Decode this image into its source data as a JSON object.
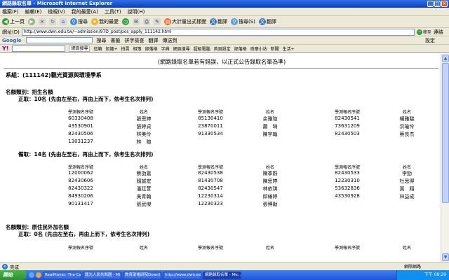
{
  "window": {
    "title": "網路錄取名單 - Microsoft Internet Explorer"
  },
  "menu": [
    "檔案(F)",
    "編輯(E)",
    "檢視(V)",
    "我的最愛(A)",
    "工具(T)",
    "說明(H)"
  ],
  "toolbar": {
    "back": "上一頁",
    "search": "搜尋",
    "favorites": "我的最愛",
    "print_ext": "大計量出式樣變",
    "translate": "翻譯",
    "search2": "搜尋(S)",
    "translate2": "翻譯"
  },
  "address": {
    "label": "網址(D)",
    "url": "http://www.dwn.edu.tw/~admission/97D_post/pos_apply_111142.html",
    "go": "移至",
    "links": "連結"
  },
  "google": {
    "label": "Google",
    "go": "搜尋",
    "bookmarks": "書籤",
    "spell": "拼字檢查",
    "translate": "翻譯",
    "send": "傳送到",
    "settings": "設定"
  },
  "yahoo": {
    "label": "Y!",
    "search_btn": "網頁搜尋",
    "items": [
      "信箱",
      "知識+",
      "拍賣",
      "相簿",
      "部落格",
      "字典",
      "網頁搜尋",
      "超級電腦",
      "首頁設定",
      "部落格",
      "奇摩小站",
      "新聞",
      "生活+"
    ]
  },
  "page": {
    "notice": "(網路錄取名單若有錯誤，以正式公告錄取名單為準)",
    "dept": "系組：(111142)觀光資源與環境學系",
    "cat1": "名額類別：招生名額",
    "admitted_label": "正取：10名 (先由左至右，再由上而下，依考生名次排列)",
    "col_hdr_id": "學測報名序號",
    "col_hdr_name": "姓名",
    "admitted": [
      [
        "60330408",
        "張思婷",
        "85130410",
        "余雅瑄",
        "82430541",
        "楊雅駿"
      ],
      [
        "43530901",
        "張婷貞",
        "23870011",
        "蕭　琦",
        "73631209",
        "洪瑜伶"
      ],
      [
        "82430506",
        "林美伶",
        "91330534",
        "陳宇翰",
        "82430503",
        "蔡良杰"
      ],
      [
        "13031237",
        "林　暄",
        "",
        "",
        "",
        ""
      ]
    ],
    "waitlist_label": "備取：14名 (先由左至右，再由上而下，依考生名次排列)",
    "waitlist": [
      [
        "12000062",
        "蔡劭嘉",
        "82430538",
        "陳季蔚",
        "82430533",
        "李勁"
      ],
      [
        "82430606",
        "顏誠宏",
        "81430708",
        "陳思婷",
        "12230310",
        "杜思得"
      ],
      [
        "82430322",
        "潘廷萱",
        "82430547",
        "林依琪",
        "53632836",
        "黃　翔"
      ],
      [
        "84930206",
        "吳青翰",
        "12230314",
        "邱椿婷",
        "43530928",
        "林益成"
      ],
      [
        "90131417",
        "張武傑",
        "12230323",
        "張博勛",
        "",
        ""
      ]
    ],
    "cat2": "名額類別：原住民外加名額",
    "cat2_admitted_label": "正取：0名 (先由左至右，再由上而下，依考生名次排列)"
  },
  "status": {
    "text": "完成",
    "zone": "網際網路"
  },
  "taskbar": {
    "start": "開始",
    "tasks": [
      "RealPlayer: The Callin...",
      "龍光人民共和國 - Mi...",
      "教育部電研院Downl...",
      "http://www.dwn.edu.t...",
      "網路錄取名單 - Mic..."
    ],
    "active_index": 4,
    "clock": "下午 08:29"
  },
  "colors": {
    "titlebar": "#0a3fc0",
    "chrome": "#ece9d8",
    "taskbar": "#245edb"
  }
}
